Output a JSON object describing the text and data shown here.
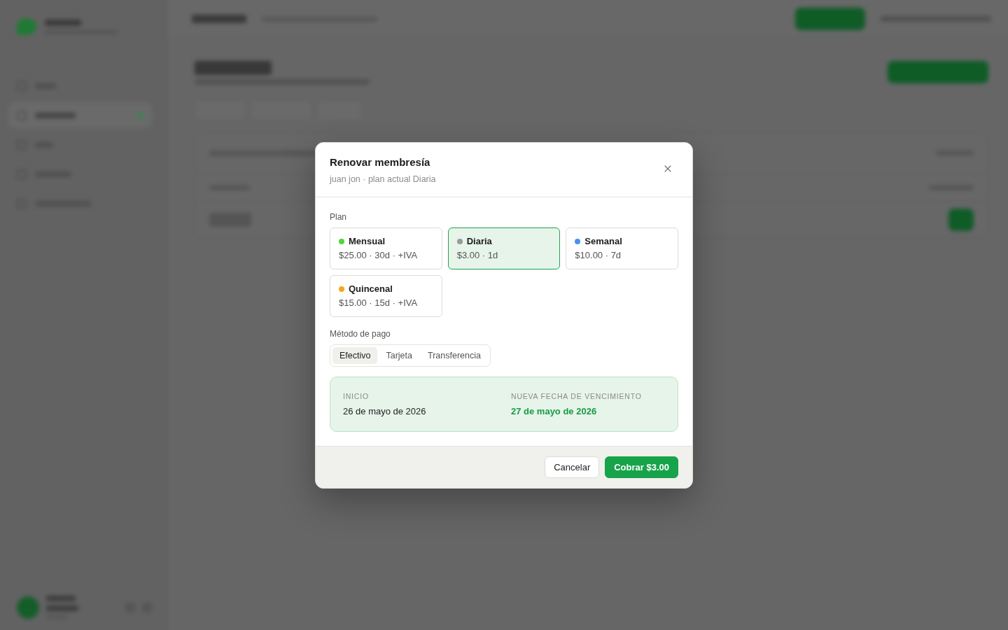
{
  "dialog": {
    "title": "Renovar membresía",
    "subtitle": "juan jon · plan actual Diaria"
  },
  "plan": {
    "label": "Plan",
    "options": [
      {
        "name": "Mensual",
        "details": "$25.00 · 30d · +IVA",
        "color": "#52d63c",
        "selected": false
      },
      {
        "name": "Diaria",
        "details": "$3.00 · 1d",
        "color": "#9a9a9a",
        "selected": true
      },
      {
        "name": "Semanal",
        "details": "$10.00 · 7d",
        "color": "#4a90f0",
        "selected": false
      },
      {
        "name": "Quincenal",
        "details": "$15.00 · 15d · +IVA",
        "color": "#f5a623",
        "selected": false
      }
    ]
  },
  "payment_method": {
    "label": "Método de pago",
    "options": [
      {
        "label": "Efectivo",
        "selected": true
      },
      {
        "label": "Tarjeta",
        "selected": false
      },
      {
        "label": "Transferencia",
        "selected": false
      }
    ]
  },
  "summary": {
    "start": {
      "label": "INICIO",
      "value": "26 de mayo de 2026"
    },
    "new_expiry": {
      "label": "NUEVA FECHA DE VENCIMIENTO",
      "value": "27 de mayo de 2026"
    }
  },
  "footer": {
    "buttons": [
      {
        "label": "Cancelar",
        "kind": "secondary"
      },
      {
        "label": "Cobrar $3.00",
        "kind": "primary"
      }
    ]
  }
}
